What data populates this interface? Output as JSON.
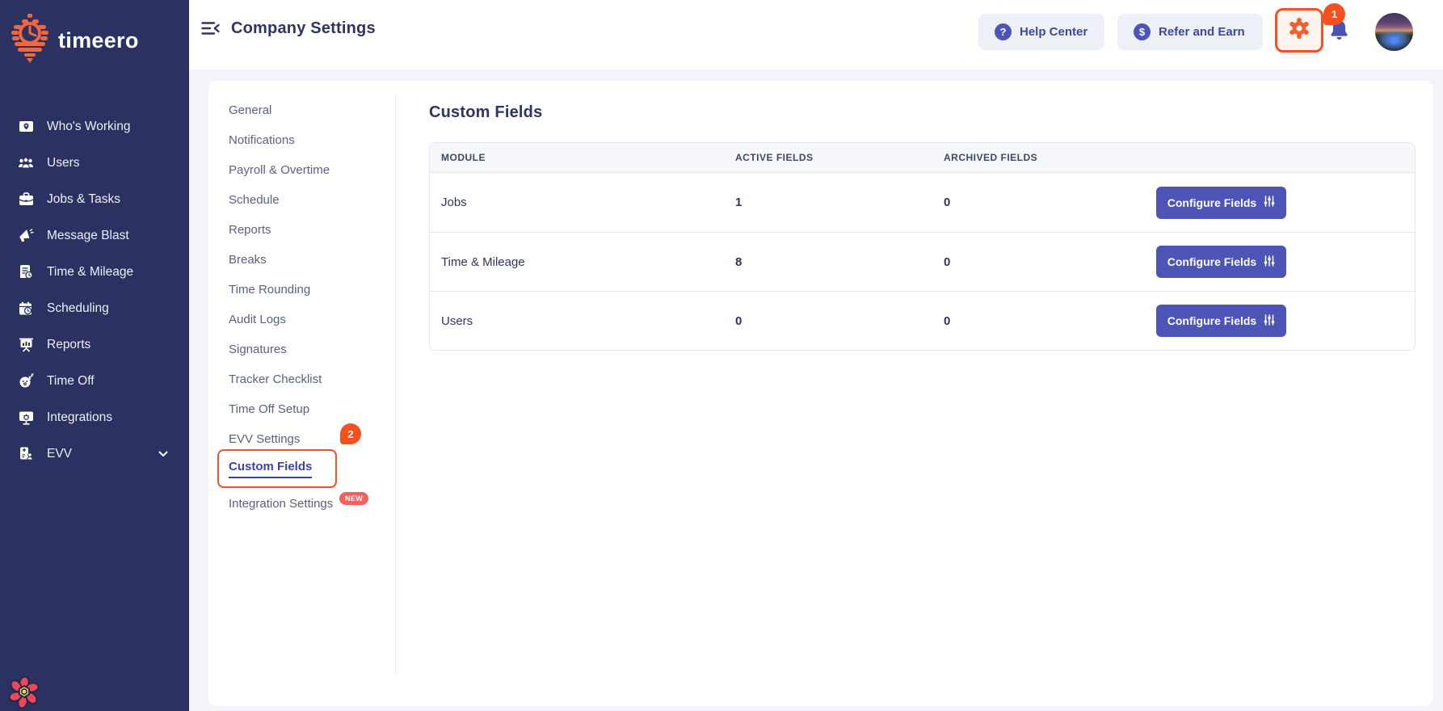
{
  "brand": {
    "name": "timeero"
  },
  "sidebar": {
    "items": [
      {
        "label": "Who's Working",
        "icon": "map-pin-icon"
      },
      {
        "label": "Users",
        "icon": "users-icon"
      },
      {
        "label": "Jobs & Tasks",
        "icon": "briefcase-icon"
      },
      {
        "label": "Message Blast",
        "icon": "megaphone-icon"
      },
      {
        "label": "Time & Mileage",
        "icon": "document-clock-icon"
      },
      {
        "label": "Scheduling",
        "icon": "calendar-icon"
      },
      {
        "label": "Reports",
        "icon": "presentation-icon"
      },
      {
        "label": "Time Off",
        "icon": "sleep-face-icon"
      },
      {
        "label": "Integrations",
        "icon": "monitor-icon"
      },
      {
        "label": "EVV",
        "icon": "id-badge-icon"
      }
    ]
  },
  "header": {
    "title": "Company Settings",
    "help_label": "Help Center",
    "help_glyph": "?",
    "refer_label": "Refer and Earn",
    "refer_glyph": "$",
    "notification_count": "1"
  },
  "settings_nav": {
    "items": [
      {
        "label": "General"
      },
      {
        "label": "Notifications"
      },
      {
        "label": "Payroll & Overtime"
      },
      {
        "label": "Schedule"
      },
      {
        "label": "Reports"
      },
      {
        "label": "Breaks"
      },
      {
        "label": "Time Rounding"
      },
      {
        "label": "Audit Logs"
      },
      {
        "label": "Signatures"
      },
      {
        "label": "Tracker Checklist"
      },
      {
        "label": "Time Off Setup"
      },
      {
        "label": "EVV Settings",
        "badge": "2"
      },
      {
        "label": "Custom Fields",
        "active": true
      },
      {
        "label": "Integration Settings",
        "new_badge": "NEW"
      }
    ]
  },
  "content": {
    "heading": "Custom Fields",
    "table": {
      "columns": {
        "module": "MODULE",
        "active": "ACTIVE FIELDS",
        "archived": "ARCHIVED FIELDS"
      },
      "rows": [
        {
          "module": "Jobs",
          "active": "1",
          "archived": "0",
          "action": "Configure Fields"
        },
        {
          "module": "Time & Mileage",
          "active": "8",
          "archived": "0",
          "action": "Configure Fields"
        },
        {
          "module": "Users",
          "active": "0",
          "archived": "0",
          "action": "Configure Fields"
        }
      ]
    }
  },
  "colors": {
    "sidebar_navy": "#2b3161",
    "accent_orange": "#f05f2c",
    "highlight_red": "#f4502a",
    "indigo": "#4c54b6",
    "green": "#27a05d",
    "badge_red": "#f4511e",
    "new_badge_red": "#f4605e",
    "page_bg": "#f4f5fa"
  }
}
